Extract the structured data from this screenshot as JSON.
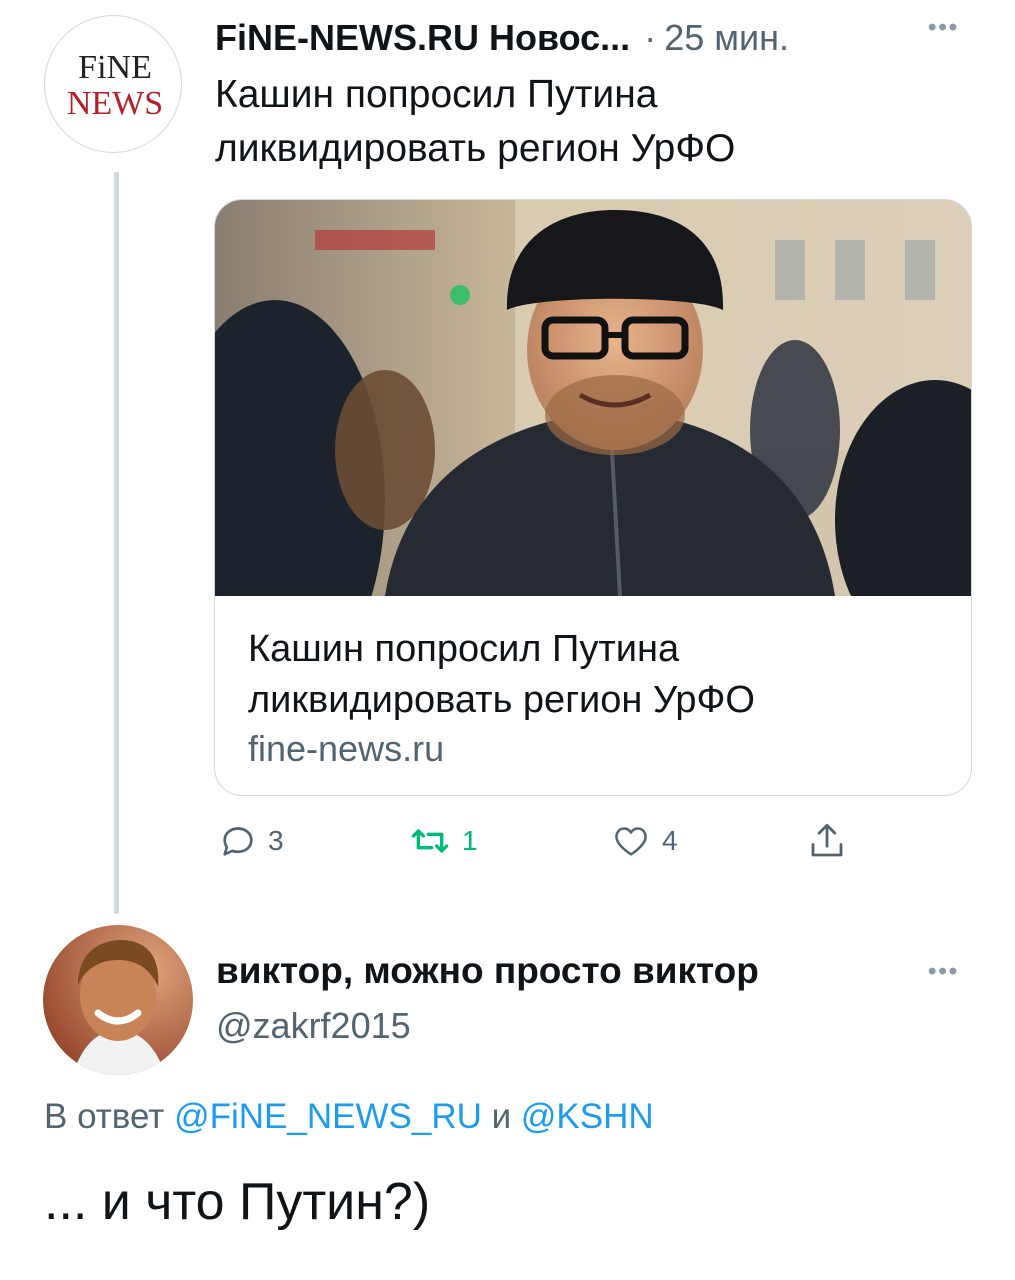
{
  "tweet1": {
    "author_name": "FiNE-NEWS.RU Новос...",
    "dot": "·",
    "time": "25 мин.",
    "text": "Кашин попросил Путина ликвидировать регион УрФО",
    "avatar": {
      "logo_line1": "FiNE",
      "logo_line2": "NEWS",
      "icon": "fine-news-logo"
    },
    "card": {
      "title": "Кашин попросил Путина ликвидировать регион УрФО",
      "domain": "fine-news.ru",
      "image": "photo of man in fur hat and glasses on street"
    },
    "actions": {
      "reply_count": "3",
      "retweet_count": "1",
      "like_count": "4"
    },
    "colors": {
      "retweet_active": "#00ba7c",
      "secondary_text": "#536471"
    }
  },
  "tweet2": {
    "author_name": "виктор, можно просто виктор",
    "handle": "@zakrf2015",
    "reply_prefix": "В ответ",
    "mention1": "@FiNE_NEWS_RU",
    "reply_and": "и",
    "mention2": "@KSHN",
    "text": "... и что Путин?)",
    "colors": {
      "mention": "#1d9bf0"
    }
  }
}
